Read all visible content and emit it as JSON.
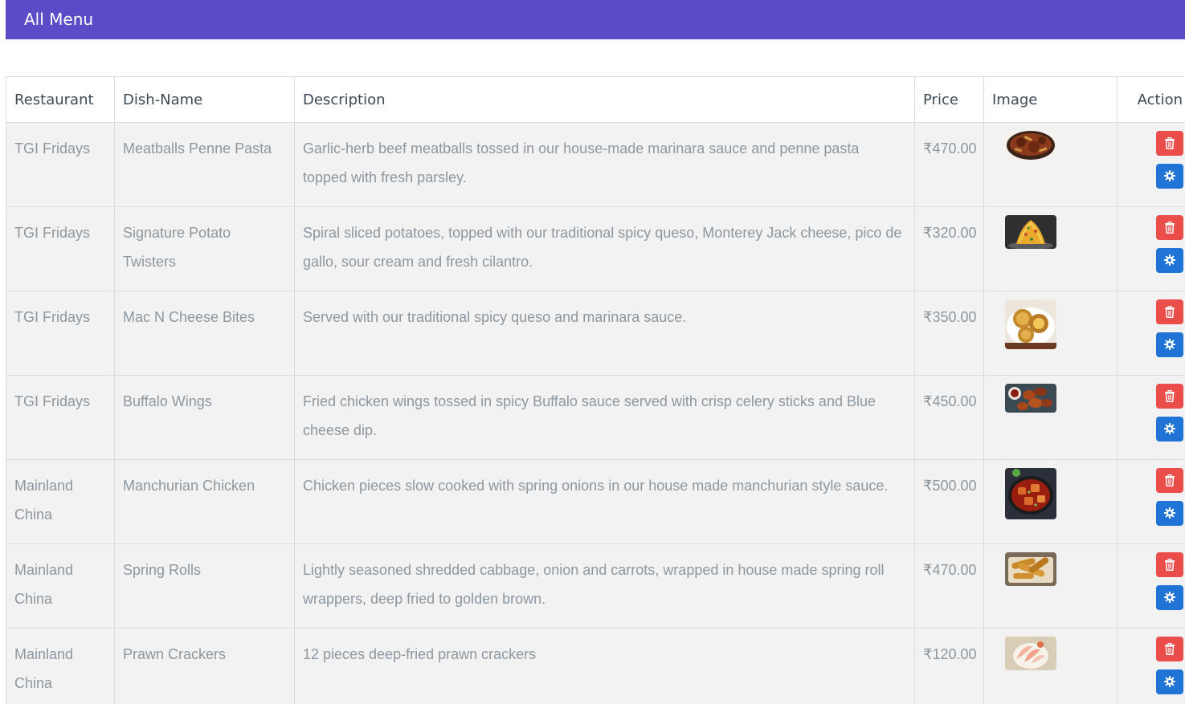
{
  "header": {
    "title": "All Menu"
  },
  "table": {
    "columns": [
      "Restaurant",
      "Dish-Name",
      "Description",
      "Price",
      "Image",
      "Action"
    ],
    "rows": [
      {
        "restaurant": "TGI Fridays",
        "dish": "Meatballs Penne Pasta",
        "description": "Garlic-herb beef meatballs tossed in our house-made marinara sauce and penne pasta topped with fresh parsley.",
        "price": "₹470.00",
        "image_icon": "pasta-photo"
      },
      {
        "restaurant": "TGI Fridays",
        "dish": "Signature Potato Twisters",
        "description": "Spiral sliced potatoes, topped with our traditional spicy queso, Monterey Jack cheese, pico de gallo, sour cream and fresh cilantro.",
        "price": "₹320.00",
        "image_icon": "potato-twisters-photo"
      },
      {
        "restaurant": "TGI Fridays",
        "dish": "Mac N Cheese Bites",
        "description": "Served with our traditional spicy queso and marinara sauce.",
        "price": "₹350.00",
        "image_icon": "mac-cheese-bites-photo"
      },
      {
        "restaurant": "TGI Fridays",
        "dish": "Buffalo Wings",
        "description": "Fried chicken wings tossed in spicy Buffalo sauce served with crisp celery sticks and Blue cheese dip.",
        "price": "₹450.00",
        "image_icon": "buffalo-wings-photo"
      },
      {
        "restaurant": "Mainland China",
        "dish": "Manchurian Chicken",
        "description": "Chicken pieces slow cooked with spring onions in our house made manchurian style sauce.",
        "price": "₹500.00",
        "image_icon": "manchurian-chicken-photo"
      },
      {
        "restaurant": "Mainland China",
        "dish": "Spring Rolls",
        "description": "Lightly seasoned shredded cabbage, onion and carrots, wrapped in house made spring roll wrappers, deep fried to golden brown.",
        "price": "₹470.00",
        "image_icon": "spring-rolls-photo"
      },
      {
        "restaurant": "Mainland China",
        "dish": "Prawn Crackers",
        "description": "12 pieces deep-fried prawn crackers",
        "price": "₹120.00",
        "image_icon": "prawn-crackers-photo"
      }
    ],
    "actions": {
      "delete_icon": "trash-icon",
      "edit_icon": "gear-icon"
    }
  },
  "colors": {
    "header_bg": "#5c4bc7",
    "row_bg": "#f2f2f2",
    "delete_button": "#eb4d4b",
    "edit_button": "#1f74d6",
    "body_text": "#8d979f",
    "heading_text": "#3d4a55"
  }
}
